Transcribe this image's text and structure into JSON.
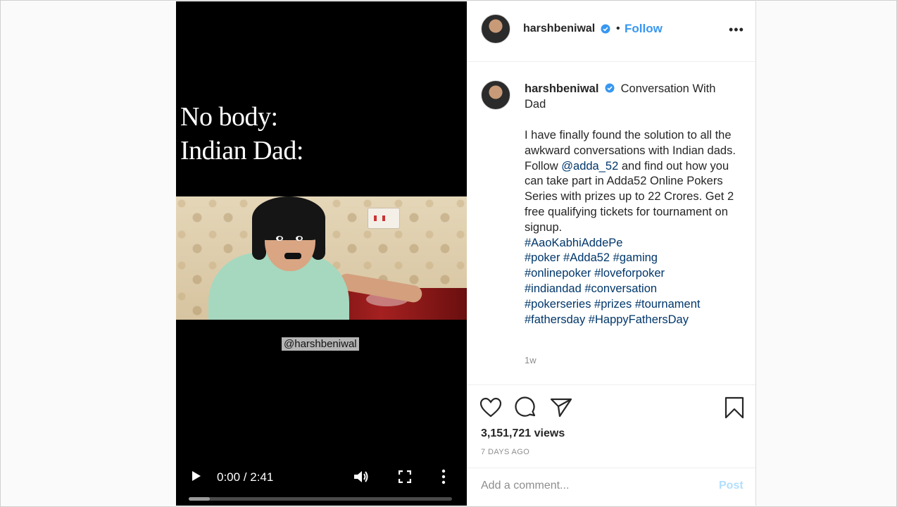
{
  "video": {
    "overlay_line1": "No body:",
    "overlay_line2": "Indian Dad:",
    "watermark": "@harshbeniwal",
    "time": "0:00 / 2:41",
    "progress_buffered": 0.08,
    "icons": [
      "play-icon",
      "volume-icon",
      "fullscreen-icon",
      "more-vertical-icon"
    ]
  },
  "header": {
    "username": "harshbeniwal",
    "dot": "•",
    "follow_label": "Follow",
    "more": "•••"
  },
  "caption": {
    "username": "harshbeniwal",
    "title": "Conversation With Dad",
    "body_part1": "I have finally found the solution to all the awkward conversations with Indian dads. Follow ",
    "mention": "@adda_52",
    "body_part2": " and find out how you can take part in Adda52 Online Pokers Series with prizes up to 22 Crores. Get 2 free qualifying tickets for tournament on signup.",
    "hashtags_line1": "#AaoKabhiAddePe",
    "hashtags_line2": "#poker #Adda52 #gaming",
    "hashtags_line3": "#onlinepoker #loveforpoker",
    "hashtags_line4": "#indiandad #conversation",
    "hashtags_line5": "#pokerseries #prizes #tournament",
    "hashtags_line6": "#fathersday #HappyFathersDay",
    "age": "1w"
  },
  "stats": {
    "views": "3,151,721 views",
    "days_ago": "7 DAYS AGO"
  },
  "comment": {
    "placeholder": "Add a comment...",
    "post_label": "Post"
  },
  "colors": {
    "link": "#00376b",
    "follow": "#3897f0",
    "post_disabled": "#b2dffc",
    "verified": "#3897f0"
  }
}
